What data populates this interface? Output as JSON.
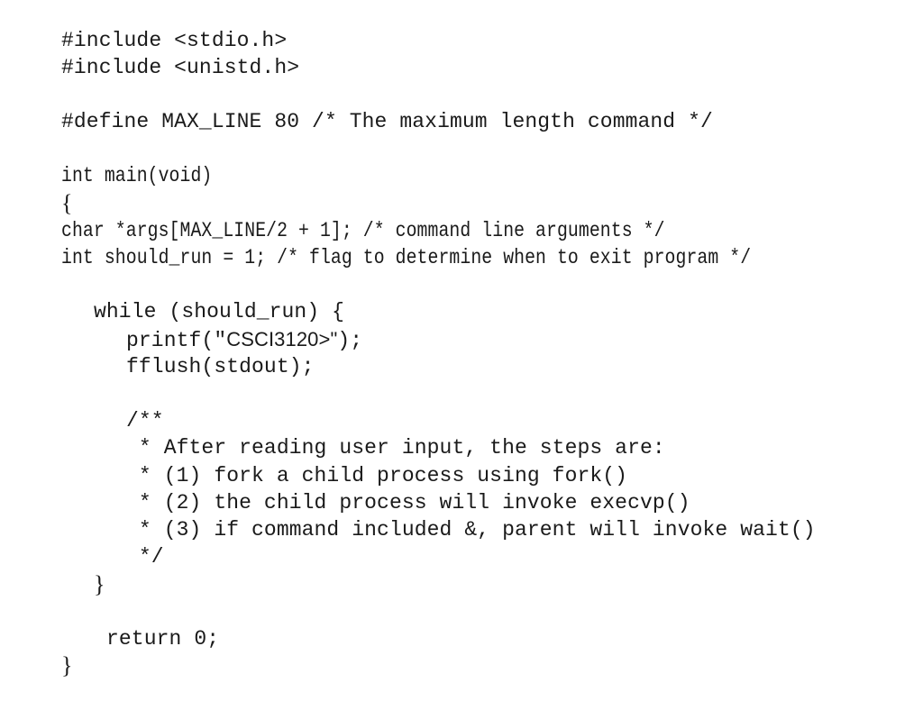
{
  "document": {
    "type": "c-source-listing",
    "lines": {
      "include_stdio": "#include <stdio.h>",
      "include_unistd": "#include <unistd.h>",
      "define_max_line": "#define MAX_LINE 80 /* The maximum length command */",
      "main_signature": "int main(void)",
      "main_open_brace": "{",
      "args_decl": "char *args[MAX_LINE/2 + 1]; /* command line arguments */",
      "should_run_decl": "int should_run = 1; /* flag to determine when to exit program */",
      "while_header": "while (should_run) {",
      "printf_prefix": "printf(\"",
      "printf_prompt": "CSCI3120>\"",
      "printf_suffix": ");",
      "fflush_call": "fflush(stdout);",
      "comment_open": "/**",
      "comment_line_1": " * After reading user input, the steps are:",
      "comment_line_2": " * (1) fork a child process using fork()",
      "comment_line_3": " * (2) the child process will invoke execvp()",
      "comment_line_4": " * (3) if command included &, parent will invoke wait()",
      "comment_close": " */",
      "while_close_brace": "}",
      "return_stmt": "return 0;",
      "main_close_brace": "}"
    }
  }
}
